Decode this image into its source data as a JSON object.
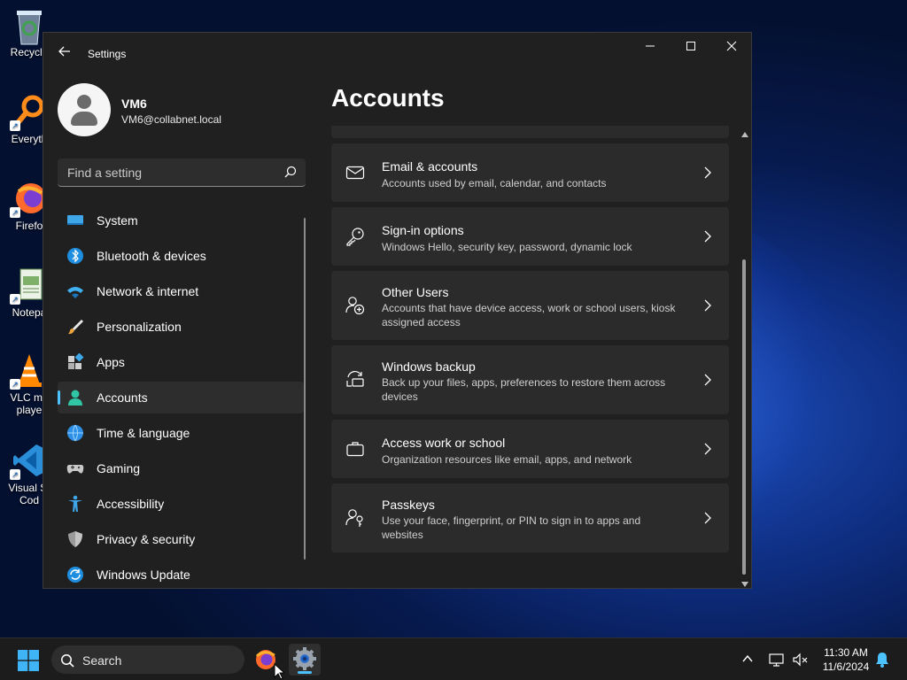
{
  "desktop": {
    "icons": [
      {
        "label": "Recycle",
        "icon": "recycle-bin-icon"
      },
      {
        "label": "Everyth",
        "icon": "everything-search-icon"
      },
      {
        "label": "Firefo",
        "icon": "firefox-icon"
      },
      {
        "label": "Notepa",
        "icon": "notepad-icon"
      },
      {
        "label": "VLC me",
        "label2": "playe",
        "icon": "vlc-icon"
      },
      {
        "label": "Visual St",
        "label2": "Cod",
        "icon": "vscode-icon"
      }
    ]
  },
  "window": {
    "title": "Settings",
    "controls": {
      "minimize": "—",
      "maximize": "☐",
      "close": "✕"
    }
  },
  "profile": {
    "name": "VM6",
    "email": "VM6@collabnet.local"
  },
  "search": {
    "placeholder": "Find a setting"
  },
  "nav": {
    "items": [
      {
        "label": "System",
        "icon": "system-icon"
      },
      {
        "label": "Bluetooth & devices",
        "icon": "bluetooth-icon"
      },
      {
        "label": "Network & internet",
        "icon": "network-icon"
      },
      {
        "label": "Personalization",
        "icon": "brush-icon"
      },
      {
        "label": "Apps",
        "icon": "apps-icon"
      },
      {
        "label": "Accounts",
        "icon": "accounts-icon",
        "active": true
      },
      {
        "label": "Time & language",
        "icon": "globe-clock-icon"
      },
      {
        "label": "Gaming",
        "icon": "gamepad-icon"
      },
      {
        "label": "Accessibility",
        "icon": "accessibility-icon"
      },
      {
        "label": "Privacy & security",
        "icon": "shield-icon"
      },
      {
        "label": "Windows Update",
        "icon": "update-icon"
      }
    ]
  },
  "main": {
    "title": "Accounts",
    "cards": [
      {
        "title": "Email & accounts",
        "desc": "Accounts used by email, calendar, and contacts",
        "icon": "mail-icon"
      },
      {
        "title": "Sign-in options",
        "desc": "Windows Hello, security key, password, dynamic lock",
        "icon": "key-icon"
      },
      {
        "title": "Other Users",
        "desc": "Accounts that have device access, work or school users, kiosk assigned access",
        "icon": "add-user-icon"
      },
      {
        "title": "Windows backup",
        "desc": "Back up your files, apps, preferences to restore them across devices",
        "icon": "backup-icon"
      },
      {
        "title": "Access work or school",
        "desc": "Organization resources like email, apps, and network",
        "icon": "briefcase-icon"
      },
      {
        "title": "Passkeys",
        "desc": "Use your face, fingerprint, or PIN to sign in to apps and websites",
        "icon": "passkey-icon"
      }
    ]
  },
  "taskbar": {
    "search_label": "Search",
    "apps": [
      {
        "name": "Firefox",
        "icon": "firefox-icon"
      },
      {
        "name": "Settings",
        "icon": "settings-gear-icon",
        "active": true
      }
    ],
    "time": "11:30 AM",
    "date": "11/6/2024"
  },
  "colors": {
    "accent": "#4cc2ff",
    "window_bg": "#202020",
    "card_bg": "#2b2b2b"
  }
}
